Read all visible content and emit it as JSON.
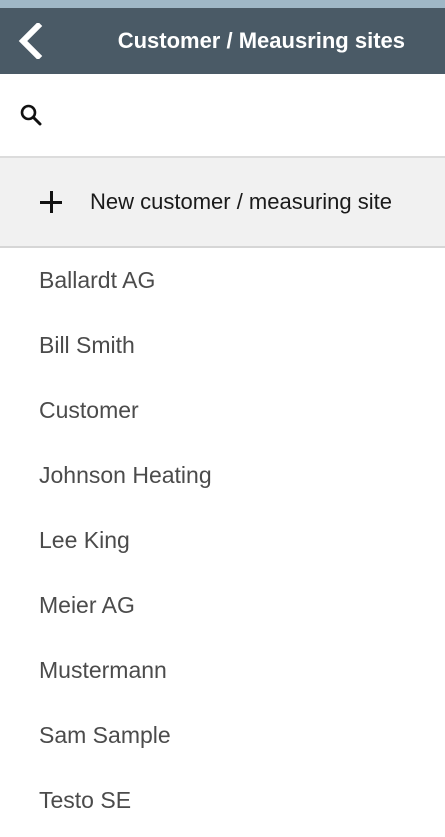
{
  "header": {
    "title": "Customer / Meausring sites",
    "back_icon": "chevron-left-icon"
  },
  "search": {
    "icon": "search-icon",
    "value": "",
    "placeholder": ""
  },
  "new_entry": {
    "icon": "plus-icon",
    "label": "New customer / measuring site"
  },
  "customers": [
    "Ballardt AG",
    "Bill Smith",
    "Customer",
    "Johnson Heating",
    "Lee King",
    "Meier AG",
    "Mustermann",
    "Sam Sample",
    "Testo SE"
  ],
  "colors": {
    "header_bg": "#4a5a66",
    "top_strip": "#9fb7c6",
    "new_row_bg": "#f1f1f1",
    "list_text": "#4b4b4b"
  }
}
